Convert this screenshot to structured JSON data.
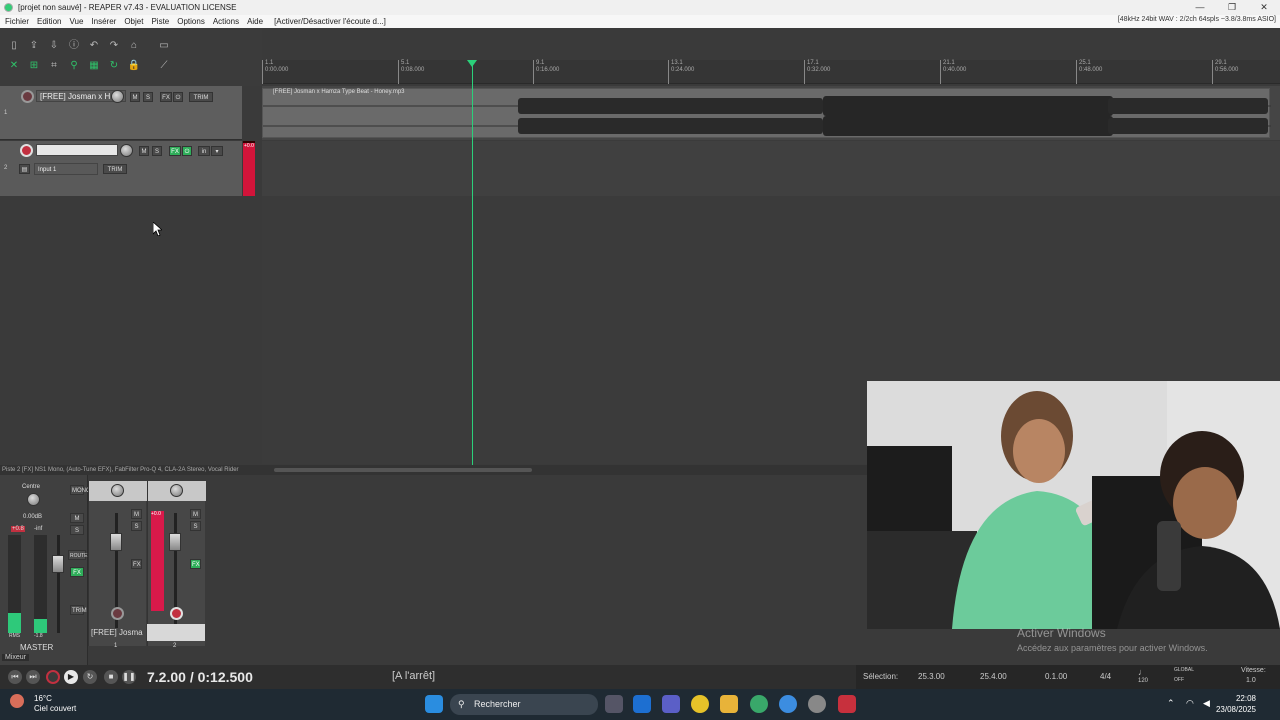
{
  "window": {
    "title": "[projet non sauvé] - REAPER v7.43 - EVALUATION LICENSE",
    "controls": [
      "—",
      "❐",
      "✕"
    ]
  },
  "menu": {
    "items": [
      "Fichier",
      "Edition",
      "Vue",
      "Insérer",
      "Objet",
      "Piste",
      "Options",
      "Actions",
      "Aide"
    ],
    "action_link": "[Activer/Désactiver l'écoute d...]",
    "audio_status": "[48kHz 24bit WAV : 2/2ch 64spls ~3.8/3.8ms ASIO]"
  },
  "ruler": {
    "marks": [
      {
        "bar": "1.1",
        "time": "0:00.000"
      },
      {
        "bar": "5.1",
        "time": "0:08.000"
      },
      {
        "bar": "9.1",
        "time": "0:16.000"
      },
      {
        "bar": "13.1",
        "time": "0:24.000"
      },
      {
        "bar": "17.1",
        "time": "0:32.000"
      },
      {
        "bar": "21.1",
        "time": "0:40.000"
      },
      {
        "bar": "25.1",
        "time": "0:48.000"
      },
      {
        "bar": "29.1",
        "time": "0:56.000"
      }
    ]
  },
  "tracks": [
    {
      "number": "1",
      "name": "[FREE] Josman x H",
      "buttons": [
        "M",
        "S",
        "FX",
        "⏻"
      ],
      "trim": "TRIM"
    },
    {
      "number": "2",
      "name": "",
      "input": "Input 1",
      "buttons": [
        "M",
        "S",
        "FX",
        "⏻",
        "in"
      ],
      "trim": "TRIM",
      "meter_peak": "+0.0"
    }
  ],
  "media_item": {
    "title": "[FREE] Josman x Hamza Type Beat - Honey.mp3"
  },
  "fx_chain_status": "Piste 2 [FX] NS1 Mono, (Auto-Tune EFX), FabFilter Pro-Q 4, CLA-2A Stereo, Vocal Rider",
  "mixer": {
    "master": {
      "pan_label": "Centre",
      "volume": "0.00dB",
      "peak_left": "+0.8",
      "peak_right": "-inf",
      "buttons": [
        "MONO",
        "M",
        "S",
        "ROUTE",
        "FX",
        "TRIM"
      ],
      "rms_left": "RMS",
      "rms_right": "-1.8",
      "label": "MASTER"
    },
    "strip_meter_peak": "+0.0",
    "strip_name": "[FREE] Josma",
    "strip_numbers": [
      "1",
      "2"
    ],
    "tab_label": "Mixeur"
  },
  "transport": {
    "position": "7.2.00 / 0:12.500",
    "state": "[A l'arrêt]",
    "selection_label": "Sélection:",
    "selection_start": "25.3.00",
    "selection_end": "25.4.00",
    "selection_length": "0.1.00",
    "time_signature": "4/4",
    "bpm": "120",
    "global_label": "GLOBAL",
    "global_state": "OFF",
    "rate_label": "Vitesse:",
    "rate_value": "1.0"
  },
  "taskbar": {
    "temperature": "16°C",
    "weather": "Ciel couvert",
    "search_placeholder": "Rechercher",
    "time": "22:08",
    "date": "23/08/2025"
  },
  "watermark": {
    "title": "Activer Windows",
    "subtitle": "Accédez aux paramètres pour activer Windows."
  },
  "colors": {
    "record": "#c23040",
    "play_cursor": "#2bd07a",
    "meter_red": "#d8194a",
    "fx_green": "#2fae5a"
  }
}
